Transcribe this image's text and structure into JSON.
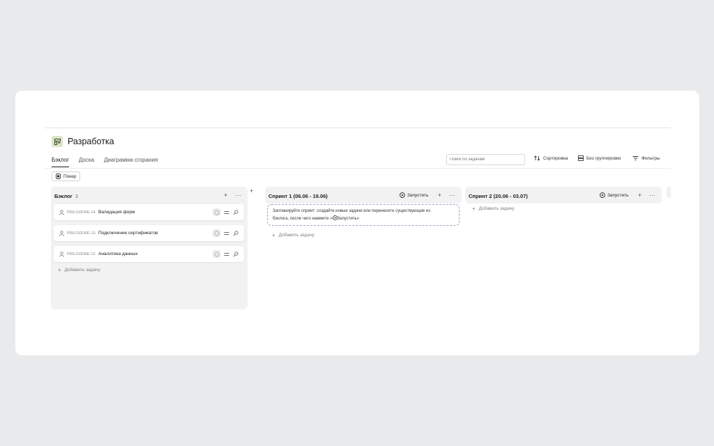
{
  "project": {
    "title": "Разработка"
  },
  "tabs": [
    {
      "label": "Бэклог",
      "active": true
    },
    {
      "label": "Доска",
      "active": false
    },
    {
      "label": "Диаграмма сгорания",
      "active": false
    }
  ],
  "search": {
    "placeholder": "Поиск по задачам"
  },
  "toolbar": {
    "sort_label": "Сортировка",
    "grouping_label": "Без группировки",
    "filters_label": "Фильтры"
  },
  "poker": {
    "label": "Покер"
  },
  "backlog": {
    "title": "Бэклог",
    "count": "3",
    "issues": [
      {
        "key": "PRILOZENIE-14",
        "title": "Валидация форм"
      },
      {
        "key": "PRILOZENIE-13",
        "title": "Подключение сертификатов"
      },
      {
        "key": "PRILOZENIE-12",
        "title": "Аналитика данных"
      }
    ],
    "add_task_label": "Добавить задачу"
  },
  "sprints": [
    {
      "title": "Спринт 1 (06.06 - 19.06)",
      "start_label": "Запустить",
      "hint_line1": "Запланируйте спринт: создайте новые задачи или перенесите существующие из",
      "hint_line2_prefix": "бэклога, после чего нажмите «",
      "hint_line2_action": "Запустить",
      "hint_line2_suffix": "»",
      "add_task_label": "Добавить задачу"
    },
    {
      "title": "Спринт 2 (20.06 - 03.07)",
      "start_label": "Запустить",
      "add_task_label": "Добавить задачу"
    }
  ],
  "icons": {
    "project_logo": "board-icon",
    "assignee": "user-icon",
    "story_points": "dashed-circle-icon",
    "priority": "equals-icon",
    "search": "magnifier-icon",
    "start": "play-circle-icon"
  },
  "colors": {
    "page_background": "#e9eaec",
    "logo_background": "#dbe5c8",
    "hint_border": "#9aa3c4"
  }
}
